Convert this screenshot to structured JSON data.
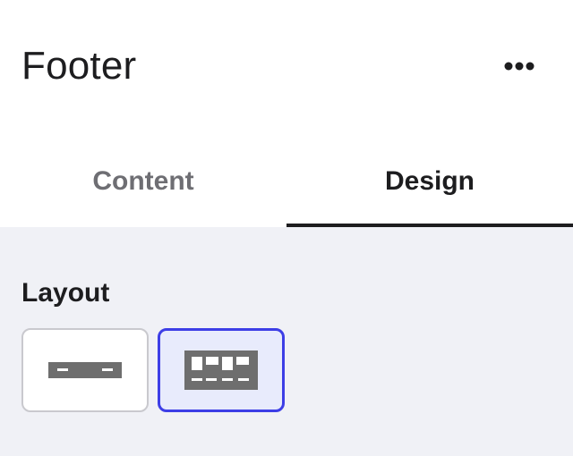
{
  "header": {
    "title": "Footer",
    "more_icon": "more-horizontal-icon"
  },
  "tabs": [
    {
      "label": "Content",
      "active": false
    },
    {
      "label": "Design",
      "active": true
    }
  ],
  "design": {
    "layout_label": "Layout",
    "layout_options": [
      {
        "icon": "footer-single-row-layout-icon",
        "selected": false
      },
      {
        "icon": "footer-columns-layout-icon",
        "selected": true
      }
    ]
  },
  "colors": {
    "accent": "#3d3ee6",
    "selected_bg": "#e8ebfc",
    "panel_bg": "#f0f1f6",
    "text": "#1d1d1f",
    "muted_text": "#6e6e73",
    "icon": "#6e6e6e"
  }
}
